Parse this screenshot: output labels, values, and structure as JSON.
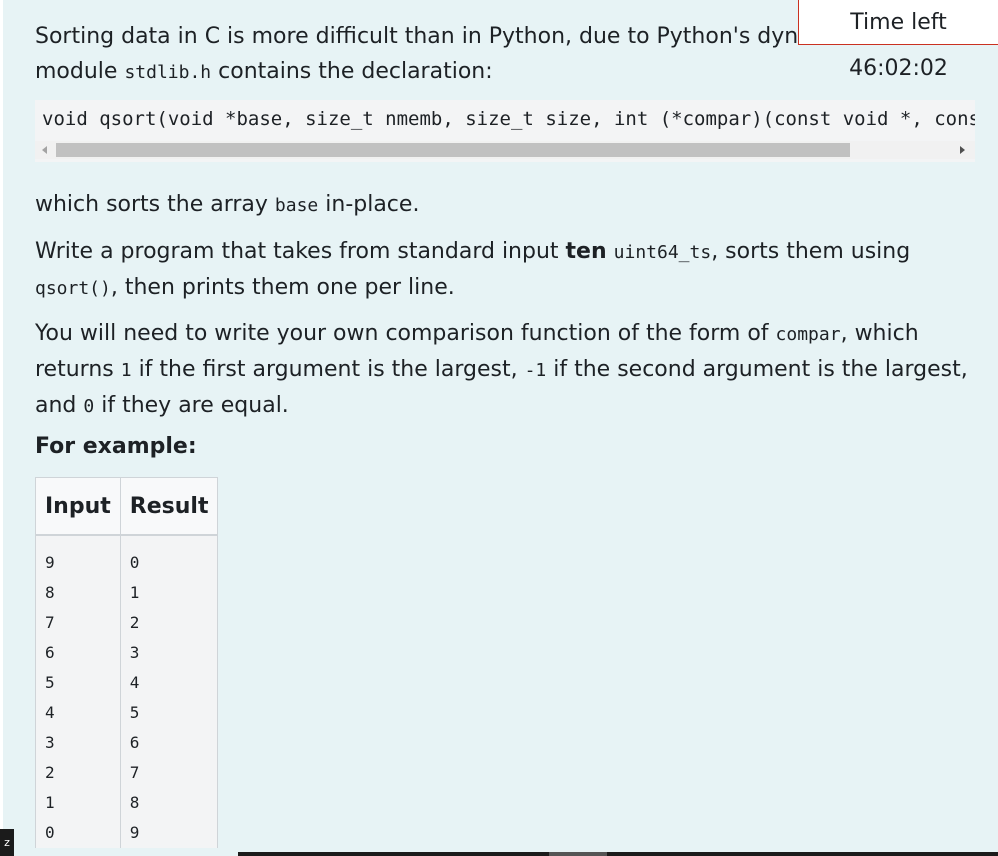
{
  "timer": {
    "label": "Time left 46:02:02"
  },
  "question": {
    "intro_text": "Sorting data in C is more difficult than in Python, due to Python's dynamic",
    "intro_line2_prefix": "module ",
    "intro_header": "stdlib.h",
    "intro_line2_suffix": " contains the declaration:",
    "declaration": "void qsort(void *base, size_t nmemb, size_t size, int (*compar)(const void *, const",
    "para1_prefix": "which sorts the array ",
    "para1_code": "base",
    "para1_suffix": " in-place.",
    "para2_prefix": "Write a program that takes from standard input ",
    "para2_bold": "ten",
    "para2_code1": "uint64_ts",
    "para2_middle": ", sorts them using ",
    "para2_code2": "qsort()",
    "para2_suffix": ", then prints them one per line.",
    "para3_prefix": "You will need to write your own comparison function of the form of ",
    "para3_code1": "compar",
    "para3_mid1": ", which returns ",
    "para3_code2": "1",
    "para3_mid2": " if the first argument is the largest, ",
    "para3_code3": "-1",
    "para3_mid3": " if the second argument is the largest, and ",
    "para3_code4": "0",
    "para3_suffix": " if they are equal.",
    "example_heading": "For example:"
  },
  "example_table": {
    "headers": [
      "Input",
      "Result"
    ],
    "input_lines": [
      "9",
      "8",
      "7",
      "6",
      "5",
      "4",
      "3",
      "2",
      "1",
      "0"
    ],
    "result_lines": [
      "0",
      "1",
      "2",
      "3",
      "4",
      "5",
      "6",
      "7",
      "8",
      "9"
    ]
  },
  "corner_tag": {
    "label": "z"
  }
}
